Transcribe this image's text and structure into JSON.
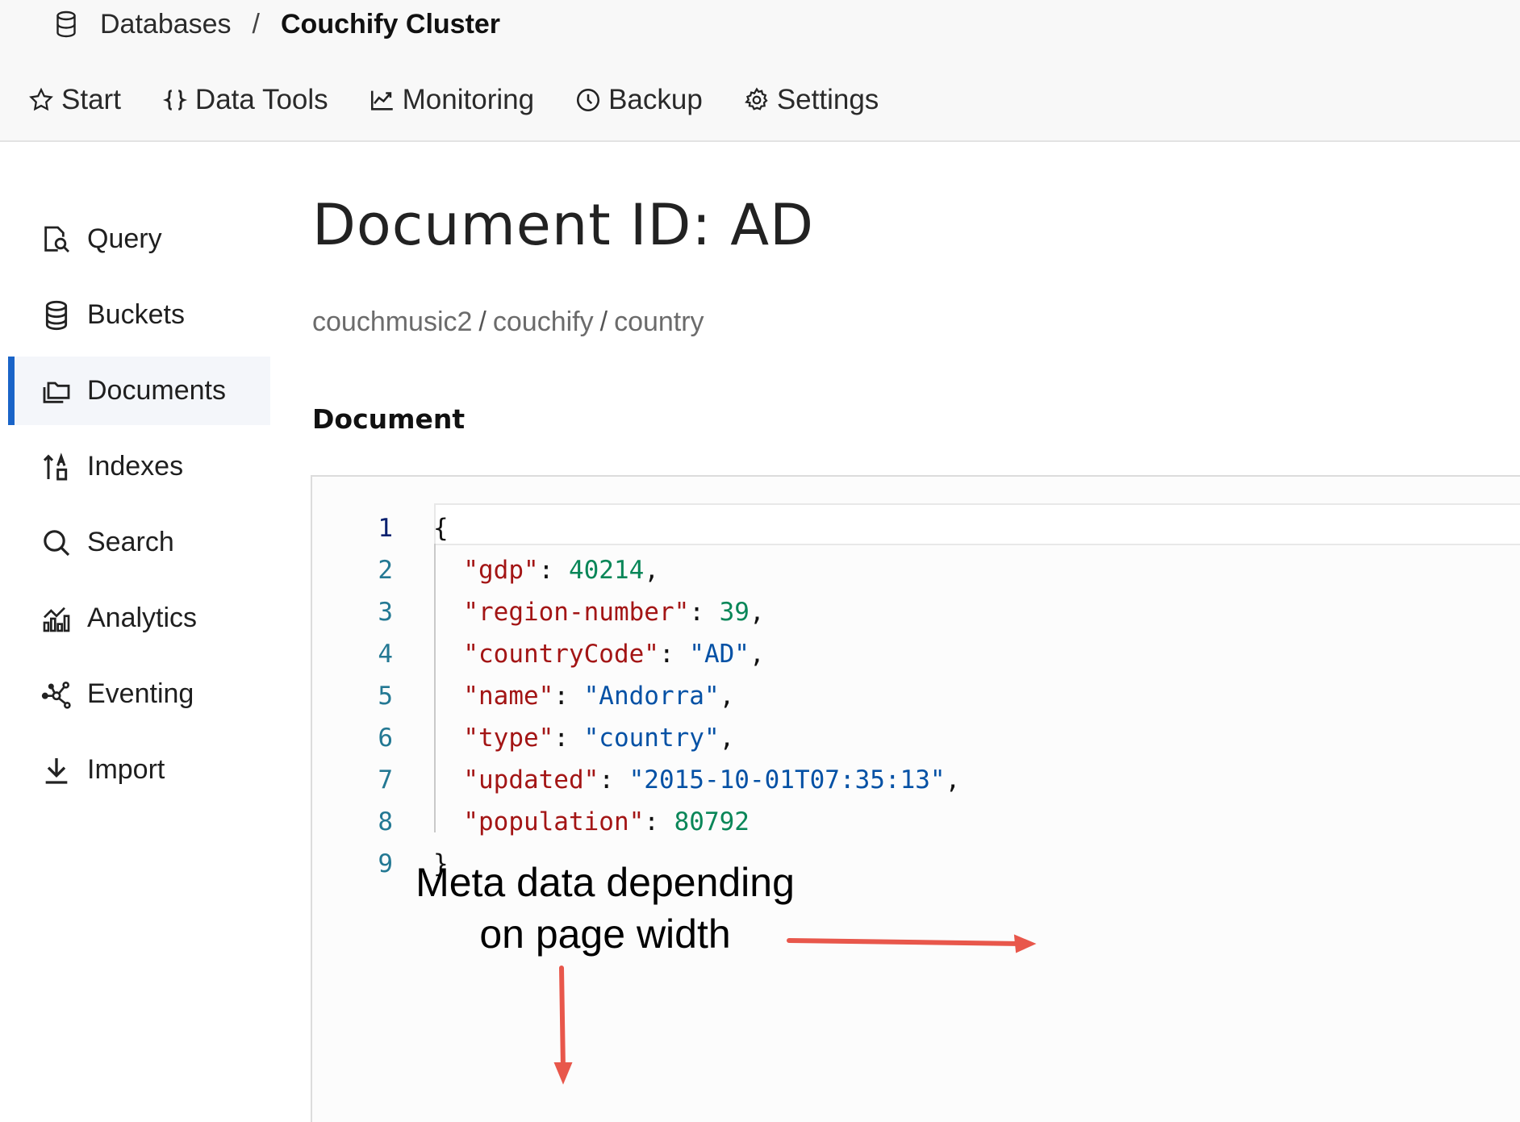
{
  "header": {
    "breadcrumb": {
      "parent": "Databases",
      "separator": "/",
      "current": "Couchify Cluster",
      "icon": "database-icon"
    },
    "tabs": [
      {
        "label": "Start",
        "icon": "star-icon"
      },
      {
        "label": "Data Tools",
        "icon": "braces-icon"
      },
      {
        "label": "Monitoring",
        "icon": "chart-line-icon"
      },
      {
        "label": "Backup",
        "icon": "clock-icon"
      },
      {
        "label": "Settings",
        "icon": "gear-icon"
      }
    ]
  },
  "sidebar": {
    "active": "Documents",
    "items": [
      {
        "label": "Query",
        "icon": "query-icon"
      },
      {
        "label": "Buckets",
        "icon": "database-icon"
      },
      {
        "label": "Documents",
        "icon": "documents-icon"
      },
      {
        "label": "Indexes",
        "icon": "indexes-icon"
      },
      {
        "label": "Search",
        "icon": "search-icon"
      },
      {
        "label": "Analytics",
        "icon": "analytics-icon"
      },
      {
        "label": "Eventing",
        "icon": "eventing-icon"
      },
      {
        "label": "Import",
        "icon": "download-icon"
      }
    ]
  },
  "main": {
    "title": "Document ID: AD",
    "path": {
      "bucket": "couchmusic2",
      "scope": "couchify",
      "collection": "country",
      "separator": "/"
    },
    "section_label": "Document",
    "editor": {
      "lines": [
        {
          "n": "1",
          "open": "{"
        },
        {
          "n": "2",
          "key": "\"gdp\"",
          "value": "40214",
          "kind": "num",
          "comma": ","
        },
        {
          "n": "3",
          "key": "\"region-number\"",
          "value": "39",
          "kind": "num",
          "comma": ","
        },
        {
          "n": "4",
          "key": "\"countryCode\"",
          "value": "\"AD\"",
          "kind": "str",
          "comma": ","
        },
        {
          "n": "5",
          "key": "\"name\"",
          "value": "\"Andorra\"",
          "kind": "str",
          "comma": ","
        },
        {
          "n": "6",
          "key": "\"type\"",
          "value": "\"country\"",
          "kind": "str",
          "comma": ","
        },
        {
          "n": "7",
          "key": "\"updated\"",
          "value": "\"2015-10-01T07:35:13\"",
          "kind": "str",
          "comma": ","
        },
        {
          "n": "8",
          "key": "\"population\"",
          "value": "80792",
          "kind": "num",
          "comma": ""
        },
        {
          "n": "9",
          "close": "}"
        }
      ]
    }
  },
  "annotation": {
    "line1": "Meta data depending",
    "line2": "on page width",
    "arrow_color": "#e8574b"
  }
}
